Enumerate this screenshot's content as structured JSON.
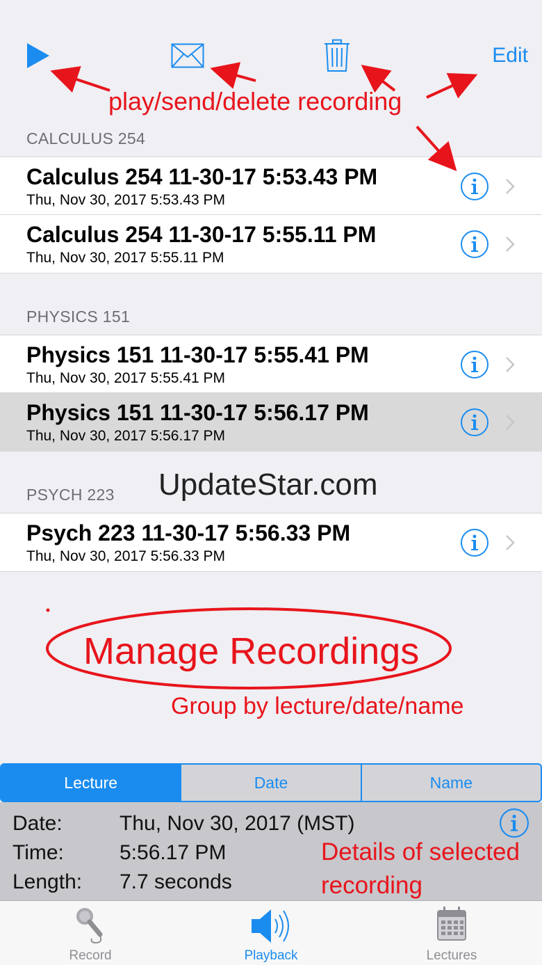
{
  "toolbar": {
    "play_icon": "play-icon",
    "mail_icon": "mail-icon",
    "trash_icon": "trash-icon",
    "edit_label": "Edit",
    "accent_color": "#1a8cf0"
  },
  "sections": [
    {
      "header": "CALCULUS 254",
      "rows": [
        {
          "title": "Calculus 254 11-30-17 5:53.43 PM",
          "subtitle": "Thu, Nov 30, 2017  5:53.43 PM"
        },
        {
          "title": "Calculus 254 11-30-17 5:55.11 PM",
          "subtitle": "Thu, Nov 30, 2017  5:55.11 PM"
        }
      ]
    },
    {
      "header": "PHYSICS 151",
      "rows": [
        {
          "title": "Physics 151 11-30-17 5:55.41 PM",
          "subtitle": "Thu, Nov 30, 2017  5:55.41 PM"
        },
        {
          "title": "Physics 151 11-30-17 5:56.17 PM",
          "subtitle": "Thu, Nov 30, 2017  5:56.17 PM",
          "selected": true
        }
      ]
    },
    {
      "header": "PSYCH 223",
      "rows": [
        {
          "title": "Psych 223 11-30-17 5:56.33 PM",
          "subtitle": "Thu, Nov 30, 2017  5:56.33 PM"
        }
      ]
    }
  ],
  "segmented": {
    "options": [
      "Lecture",
      "Date",
      "Name"
    ],
    "selected": "Lecture"
  },
  "details": {
    "date_label": "Date:",
    "date_value": "Thu, Nov 30, 2017 (MST)",
    "time_label": "Time:",
    "time_value": "5:56.17 PM",
    "length_label": "Length:",
    "length_value": "7.7 seconds"
  },
  "tabbar": {
    "tabs": [
      {
        "label": "Record",
        "icon": "microphone-icon"
      },
      {
        "label": "Playback",
        "icon": "speaker-icon",
        "active": true
      },
      {
        "label": "Lectures",
        "icon": "calendar-icon"
      }
    ]
  },
  "annotations": {
    "toolbar_note": "play/send/delete recording",
    "manage_title": "Manage Recordings",
    "group_note": "Group by lecture/date/name",
    "details_note_line1": "Details of selected",
    "details_note_line2": "recording",
    "watermark": "UpdateStar.com",
    "color": "#e8141b"
  }
}
